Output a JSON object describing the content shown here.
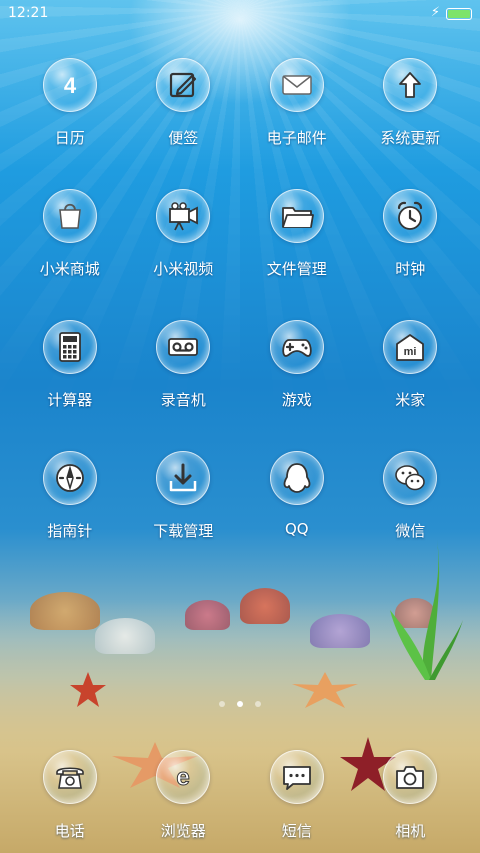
{
  "status_bar": {
    "time": "12:21",
    "battery_level": 1.0,
    "charging": true
  },
  "apps": [
    {
      "name": "calendar",
      "label": "日历",
      "icon": "calendar-icon",
      "icon_text": "4"
    },
    {
      "name": "notes",
      "label": "便签",
      "icon": "notes-icon"
    },
    {
      "name": "email",
      "label": "电子邮件",
      "icon": "mail-icon"
    },
    {
      "name": "system-update",
      "label": "系统更新",
      "icon": "arrow-up-icon"
    },
    {
      "name": "mi-store",
      "label": "小米商城",
      "icon": "shopping-bag-icon"
    },
    {
      "name": "mi-video",
      "label": "小米视频",
      "icon": "movie-camera-icon"
    },
    {
      "name": "file-manager",
      "label": "文件管理",
      "icon": "folder-icon"
    },
    {
      "name": "clock",
      "label": "时钟",
      "icon": "alarm-clock-icon"
    },
    {
      "name": "calculator",
      "label": "计算器",
      "icon": "calculator-icon"
    },
    {
      "name": "recorder",
      "label": "录音机",
      "icon": "recorder-icon"
    },
    {
      "name": "games",
      "label": "游戏",
      "icon": "gamepad-icon"
    },
    {
      "name": "mi-home",
      "label": "米家",
      "icon": "mi-home-icon",
      "icon_text": "mi"
    },
    {
      "name": "compass",
      "label": "指南针",
      "icon": "compass-icon"
    },
    {
      "name": "downloads",
      "label": "下载管理",
      "icon": "download-icon"
    },
    {
      "name": "qq",
      "label": "QQ",
      "icon": "penguin-icon"
    },
    {
      "name": "wechat",
      "label": "微信",
      "icon": "wechat-icon"
    }
  ],
  "page_indicator": {
    "count": 3,
    "active": 1
  },
  "dock": [
    {
      "name": "phone",
      "label": "电话",
      "icon": "telephone-icon"
    },
    {
      "name": "browser",
      "label": "浏览器",
      "icon": "browser-icon",
      "icon_text": "e"
    },
    {
      "name": "messages",
      "label": "短信",
      "icon": "message-icon"
    },
    {
      "name": "camera",
      "label": "相机",
      "icon": "camera-icon"
    }
  ]
}
